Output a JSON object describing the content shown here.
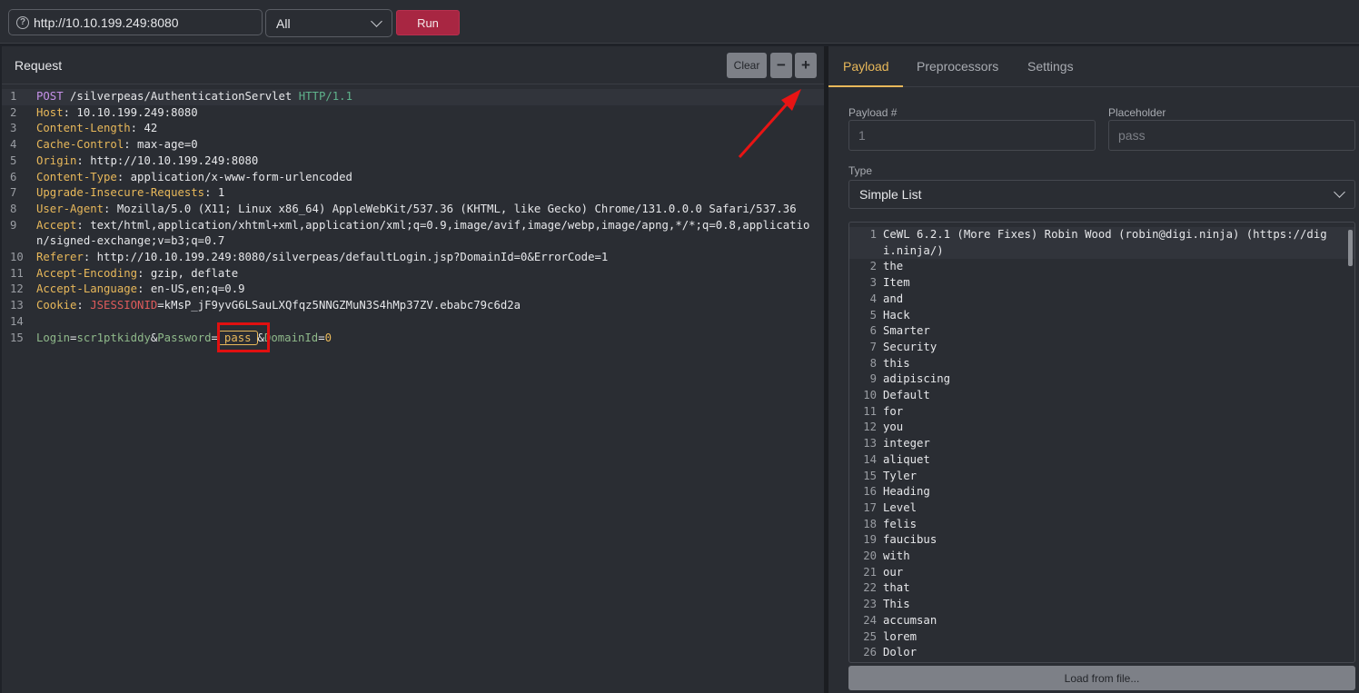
{
  "toolbar": {
    "url": "http://10.10.199.249:8080",
    "mode": "All",
    "run_label": "Run"
  },
  "request": {
    "title": "Request",
    "clear_label": "Clear",
    "minus_label": "−",
    "plus_label": "+",
    "lines": [
      {
        "n": "1",
        "parts": [
          [
            "method",
            "POST"
          ],
          [
            "plain",
            " /silverpeas/AuthenticationServlet "
          ],
          [
            "proto",
            "HTTP/1.1"
          ]
        ]
      },
      {
        "n": "2",
        "parts": [
          [
            "hdr",
            "Host"
          ],
          [
            "plain",
            ": 10.10.199.249:8080"
          ]
        ]
      },
      {
        "n": "3",
        "parts": [
          [
            "hdr",
            "Content-Length"
          ],
          [
            "plain",
            ": 42"
          ]
        ]
      },
      {
        "n": "4",
        "parts": [
          [
            "hdr",
            "Cache-Control"
          ],
          [
            "plain",
            ": max-age=0"
          ]
        ]
      },
      {
        "n": "5",
        "parts": [
          [
            "hdr",
            "Origin"
          ],
          [
            "plain",
            ": http://10.10.199.249:8080"
          ]
        ]
      },
      {
        "n": "6",
        "parts": [
          [
            "hdr",
            "Content-Type"
          ],
          [
            "plain",
            ": application/x-www-form-urlencoded"
          ]
        ]
      },
      {
        "n": "7",
        "parts": [
          [
            "hdr",
            "Upgrade-Insecure-Requests"
          ],
          [
            "plain",
            ": 1"
          ]
        ]
      },
      {
        "n": "8",
        "parts": [
          [
            "hdr",
            "User-Agent"
          ],
          [
            "plain",
            ": Mozilla/5.0 (X11; Linux x86_64) AppleWebKit/537.36 (KHTML, like Gecko) Chrome/131.0.0.0 Safari/537.36"
          ]
        ]
      },
      {
        "n": "9",
        "parts": [
          [
            "hdr",
            "Accept"
          ],
          [
            "plain",
            ": text/html,application/xhtml+xml,application/xml;q=0.9,image/avif,image/webp,image/apng,*/*;q=0.8,application/signed-exchange;v=b3;q=0.7"
          ]
        ]
      },
      {
        "n": "10",
        "parts": [
          [
            "hdr",
            "Referer"
          ],
          [
            "plain",
            ": http://10.10.199.249:8080/silverpeas/defaultLogin.jsp?DomainId=0&ErrorCode=1"
          ]
        ]
      },
      {
        "n": "11",
        "parts": [
          [
            "hdr",
            "Accept-Encoding"
          ],
          [
            "plain",
            ": gzip, deflate"
          ]
        ]
      },
      {
        "n": "12",
        "parts": [
          [
            "hdr",
            "Accept-Language"
          ],
          [
            "plain",
            ": en-US,en;q=0.9"
          ]
        ]
      },
      {
        "n": "13",
        "parts": [
          [
            "hdr",
            "Cookie"
          ],
          [
            "plain",
            ": "
          ],
          [
            "cookie",
            "JSESSIONID"
          ],
          [
            "plain",
            "=kMsP_jF9yvG6LSauLXQfqz5NNGZMuN3S4hMp37ZV.ebabc79c6d2a"
          ]
        ]
      },
      {
        "n": "14",
        "parts": []
      },
      {
        "n": "15",
        "parts": [
          [
            "param",
            "Login"
          ],
          [
            "plain",
            "="
          ],
          [
            "param",
            "scr1ptkiddy"
          ],
          [
            "plain",
            "&"
          ],
          [
            "param",
            "Password"
          ],
          [
            "plain",
            "="
          ],
          [
            "ph",
            "pass"
          ],
          [
            "plain",
            "&"
          ],
          [
            "param",
            "DomainId"
          ],
          [
            "plain",
            "="
          ],
          [
            "ph0",
            "0"
          ]
        ]
      }
    ]
  },
  "tabs": [
    "Payload",
    "Preprocessors",
    "Settings"
  ],
  "payload": {
    "payload_num_label": "Payload #",
    "payload_num_value": "1",
    "placeholder_label": "Placeholder",
    "placeholder_value": "pass",
    "type_label": "Type",
    "type_value": "Simple List",
    "load_label": "Load from file...",
    "items": [
      "CeWL 6.2.1 (More Fixes) Robin Wood (robin@digi.ninja) (https://digi.ninja/)",
      "the",
      "Item",
      "and",
      "Hack",
      "Smarter",
      "Security",
      "this",
      "adipiscing",
      "Default",
      "for",
      "you",
      "integer",
      "aliquet",
      "Tyler",
      "Heading",
      "Level",
      "felis",
      "faucibus",
      "with",
      "our",
      "that",
      "This",
      "accumsan",
      "lorem",
      "Dolor"
    ]
  }
}
